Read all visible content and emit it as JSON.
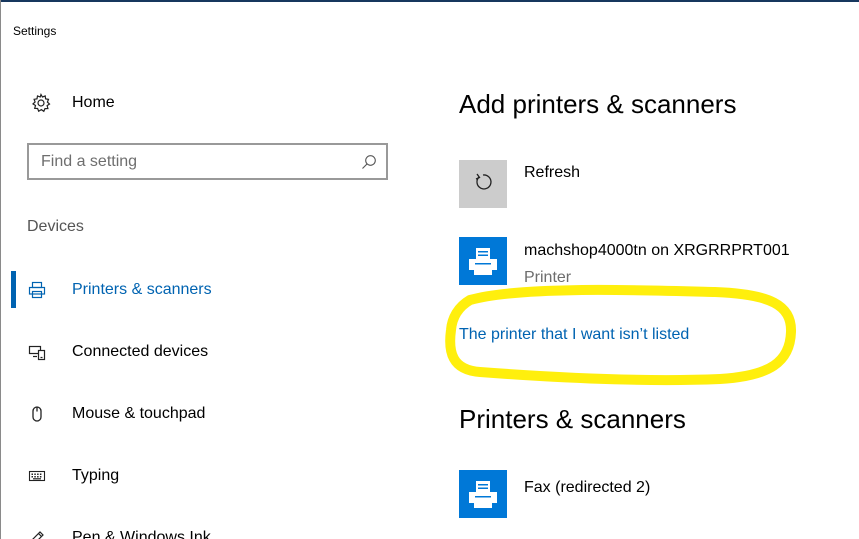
{
  "window": {
    "title": "Settings"
  },
  "sidebar": {
    "home_label": "Home",
    "home_icon": "gear-icon",
    "search": {
      "placeholder": "Find a setting",
      "value": "",
      "icon": "search-icon"
    },
    "section_label": "Devices",
    "items": [
      {
        "label": "Printers & scanners",
        "icon": "printer-icon",
        "active": true
      },
      {
        "label": "Connected devices",
        "icon": "connected-devices-icon",
        "active": false
      },
      {
        "label": "Mouse & touchpad",
        "icon": "mouse-icon",
        "active": false
      },
      {
        "label": "Typing",
        "icon": "keyboard-icon",
        "active": false
      },
      {
        "label": "Pen & Windows Ink",
        "icon": "pen-icon",
        "active": false
      }
    ]
  },
  "main": {
    "add_heading": "Add printers & scanners",
    "refresh_label": "Refresh",
    "found_device": {
      "name": "machshop4000tn on XRGRRPRT001",
      "type": "Printer"
    },
    "not_listed_link": "The printer that I want isn’t listed",
    "installed_heading": "Printers & scanners",
    "installed_devices": [
      {
        "name": "Fax (redirected 2)"
      }
    ]
  },
  "colors": {
    "accent": "#0063b1",
    "tile_blue": "#0078d7",
    "refresh_tile": "#cccccc",
    "highlight": "#ffee00"
  }
}
